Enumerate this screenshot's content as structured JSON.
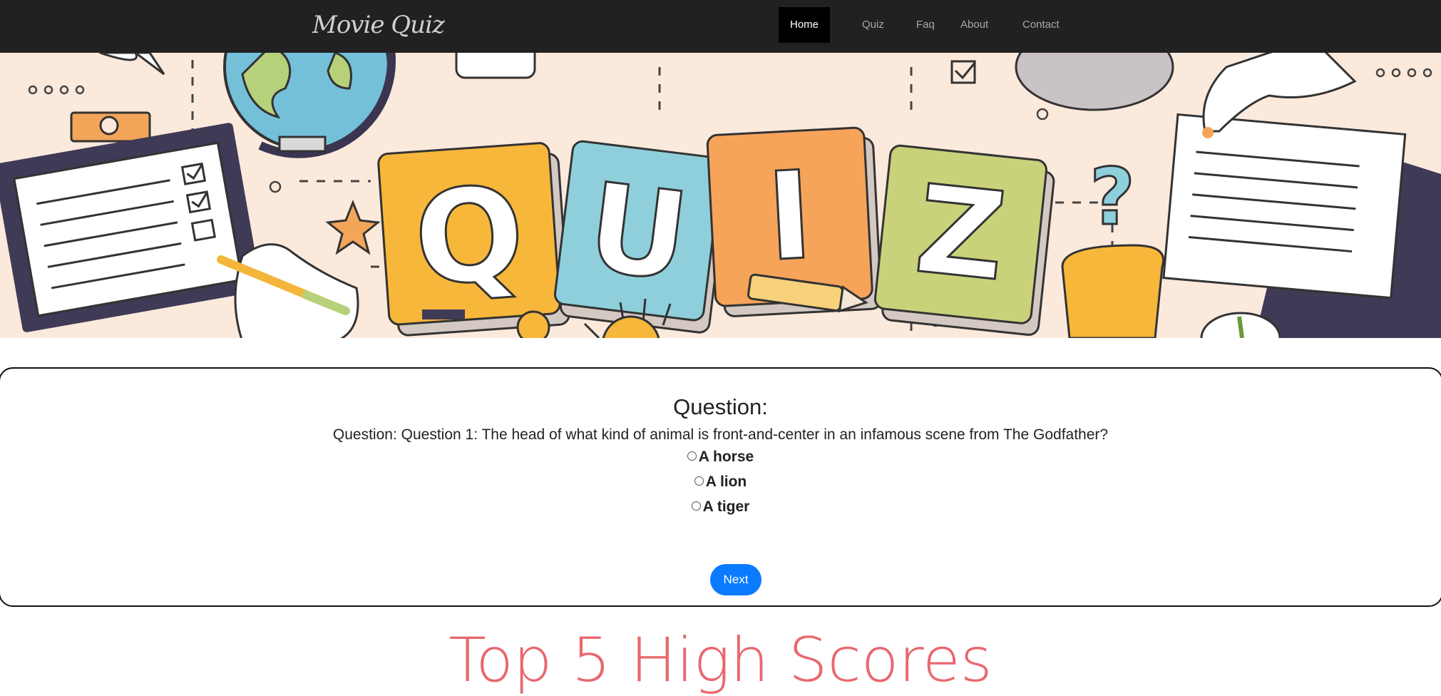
{
  "brand": {
    "logo_text": "Movie Quiz"
  },
  "nav": {
    "items": [
      {
        "label": "Home",
        "active": true
      },
      {
        "label": "Quiz",
        "active": false
      },
      {
        "label": "Faq",
        "active": false
      },
      {
        "label": "About",
        "active": false
      },
      {
        "label": "Contact",
        "active": false
      }
    ]
  },
  "hero": {
    "letters": [
      "Q",
      "U",
      "I",
      "Z"
    ],
    "colors": {
      "tile_q": "#f7b73a",
      "tile_u": "#8fcfdc",
      "tile_i": "#f6a45a",
      "tile_z": "#c9d27b",
      "background": "#fbe9dc"
    }
  },
  "quiz": {
    "heading": "Question:",
    "question_text": "Question: Question 1: The head of what kind of animal is front-and-center in an infamous scene from The Godfather?",
    "options": [
      "A horse",
      "A lion",
      "A tiger"
    ],
    "next_label": "Next"
  },
  "high_scores": {
    "title": "Top 5 High Scores"
  },
  "colors": {
    "nav_bg": "#212121",
    "accent_button": "#0a7bff",
    "scores_title": "#e8686f"
  }
}
